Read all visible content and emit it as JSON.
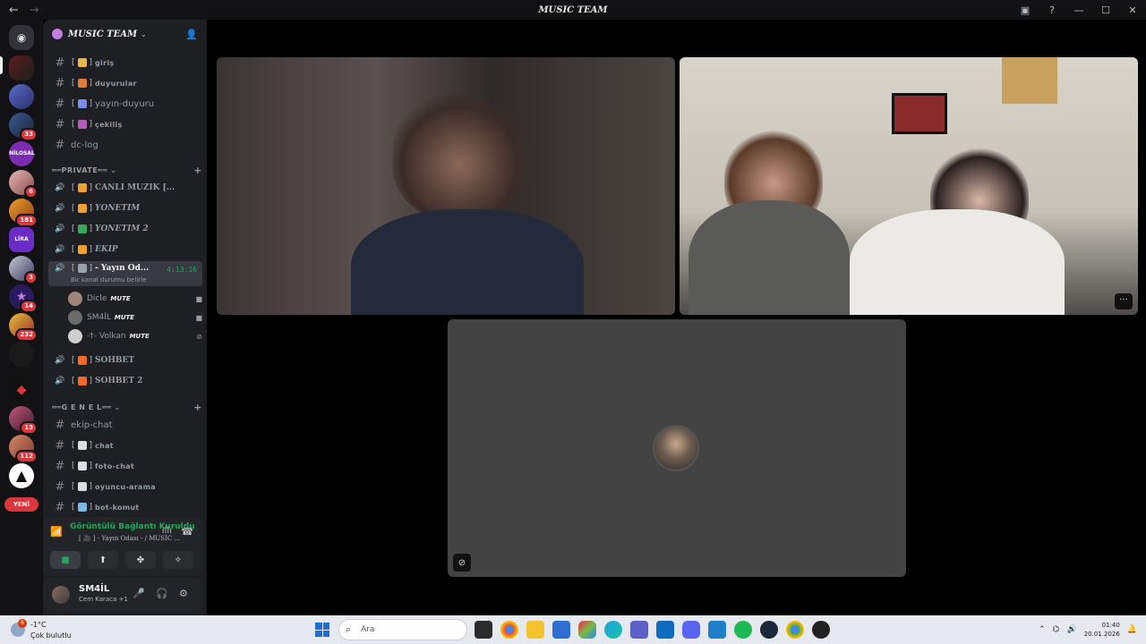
{
  "window": {
    "title": "MUSIC TEAM"
  },
  "guild": {
    "name": "MUSIC TEAM"
  },
  "channels": [
    {
      "name": "giriş",
      "type": "text",
      "style": "small"
    },
    {
      "name": "duyurular",
      "type": "text",
      "style": "small"
    },
    {
      "name": "yayın-duyuru",
      "type": "text",
      "style": "normal"
    },
    {
      "name": "çekiliş",
      "type": "text",
      "style": "small"
    },
    {
      "name": "dc-log",
      "type": "text",
      "style": "plain"
    }
  ],
  "categories": {
    "private": "PRIVATE",
    "genel": "G E N E L"
  },
  "private_channels": [
    {
      "name": "CANLI MÜZİK [...",
      "style": "serif"
    },
    {
      "name": "YÖNETİM",
      "style": "italic"
    },
    {
      "name": "YÖNETİM 2",
      "style": "italic"
    },
    {
      "name": "EKİP",
      "style": "italic"
    }
  ],
  "active_channel": {
    "name": "- Yayın Od...",
    "subtitle": "Bir kanal durumu belirle",
    "timer": "4:13:16"
  },
  "voice_users": [
    {
      "name": "Dicle",
      "mute": "MUTE"
    },
    {
      "name": "SM4İL",
      "mute": "MUTE"
    },
    {
      "name": "-†- Volkan",
      "mute": "MUTE"
    }
  ],
  "sohbet_channels": [
    {
      "name": "SOHBET"
    },
    {
      "name": "SOHBET 2"
    }
  ],
  "genel_channels": [
    {
      "name": "ekip-chat",
      "style": "plain"
    },
    {
      "name": "chat",
      "style": "small"
    },
    {
      "name": "foto-chat",
      "style": "small"
    },
    {
      "name": "oyuncu-arama",
      "style": "small"
    },
    {
      "name": "bot-komut",
      "style": "small"
    }
  ],
  "servers": {
    "badges": [
      "33",
      "6",
      "181",
      "3",
      "14",
      "232",
      "13",
      "112"
    ],
    "new_label": "YENİ",
    "named": [
      "NİLOSAL",
      "LİRA"
    ]
  },
  "voice_panel": {
    "status": "Görüntülü Bağlantı Kuruldu",
    "location": "[ 🎥 ] - Yayın Odası - / MUSIC ..."
  },
  "user": {
    "name": "SM4İL",
    "status": "Cem Karaca +1"
  },
  "taskbar": {
    "temp": "-1°C",
    "weather": "Çok bulutlu",
    "weather_badge": "6",
    "search_placeholder": "Ara",
    "time": "01:40",
    "date": "20.01.2026"
  },
  "colors": {
    "accent_green": "#23a55a",
    "badge_red": "#da373c",
    "bg_dark": "#1e1f22"
  }
}
